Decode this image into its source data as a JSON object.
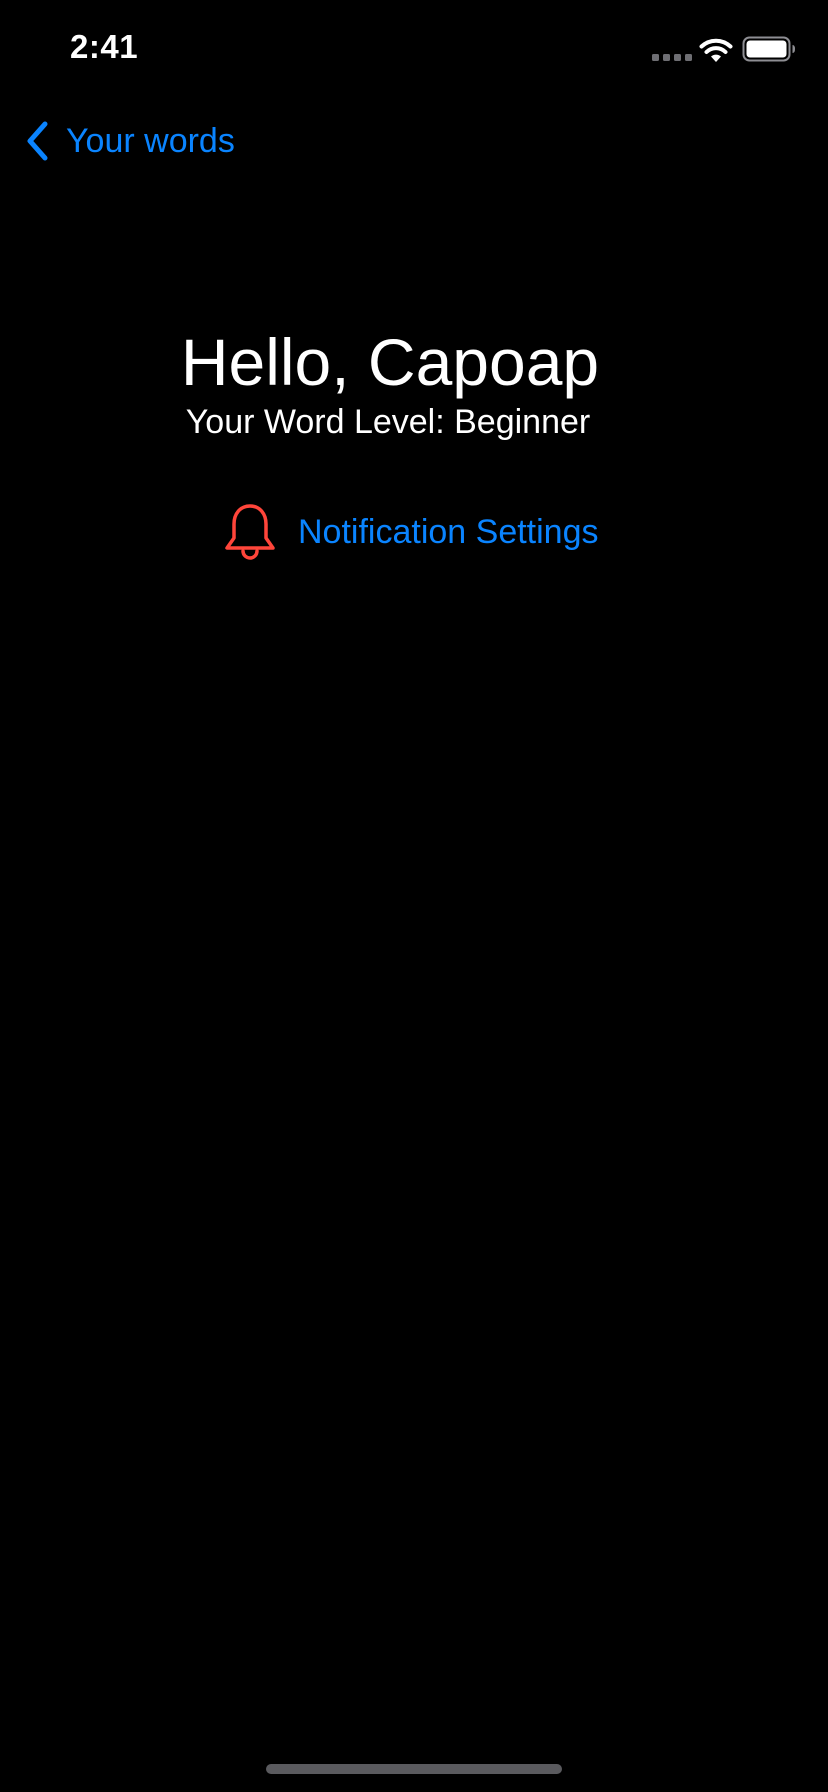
{
  "status_bar": {
    "time": "2:41"
  },
  "nav": {
    "back_label": "Your words"
  },
  "profile": {
    "greeting": "Hello, Capoap",
    "word_level": "Your Word Level: Beginner"
  },
  "settings": {
    "notification_label": "Notification Settings"
  },
  "icons": {
    "back": "chevron-left-icon",
    "bell": "bell-icon",
    "wifi": "wifi-icon",
    "battery": "battery-icon",
    "signal": "cellular-signal-icon"
  },
  "colors": {
    "background": "#000000",
    "accent": "#0a84ff",
    "bell": "#ff453a",
    "text": "#ffffff"
  }
}
